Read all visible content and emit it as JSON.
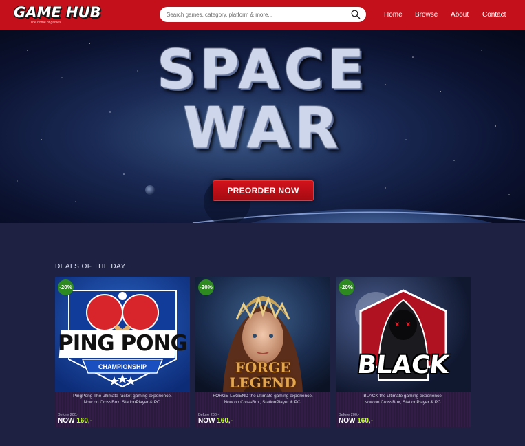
{
  "header": {
    "logo_title": "GAME HUB",
    "logo_tagline": "The home of games",
    "search_placeholder": "Search games, category, platform & more...",
    "nav": [
      "Home",
      "Browse",
      "About",
      "Contact"
    ],
    "brand_color": "#c3101b"
  },
  "hero": {
    "title_line1": "SPACE",
    "title_line2": "WAR",
    "cta_label": "PREORDER NOW"
  },
  "deals": {
    "heading": "DEALS OF THE DAY",
    "cards": [
      {
        "badge": "-20%",
        "art_line1": "PING PONG",
        "art_line2": "CHAMPIONSHIP",
        "description_line1": "PingPong The ultimate racket gaming experience.",
        "description_line2": "Now on CrossBox, StationPlayer & PC.",
        "before": "Before 200,-",
        "now_label": "NOW",
        "price": "160,-"
      },
      {
        "badge": "-20%",
        "art_line1": "FORGE",
        "art_line2": "LEGEND",
        "description_line1": "FORGE LEGEND the ultimate gaming experience.",
        "description_line2": "Now on CrossBox, StationPlayer & PC.",
        "before": "Before 200,-",
        "now_label": "NOW",
        "price": "160,-"
      },
      {
        "badge": "-20%",
        "art_line1": "BLACK",
        "art_line2": "",
        "description_line1": "BLACK the ultimate gaming experience.",
        "description_line2": "Now on CrossBox, StationPlayer & PC.",
        "before": "Before 200,-",
        "now_label": "NOW",
        "price": "160,-"
      }
    ]
  }
}
